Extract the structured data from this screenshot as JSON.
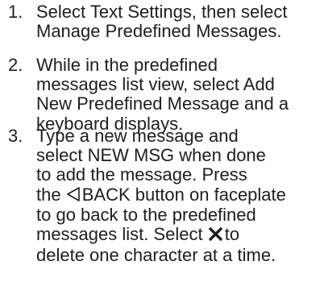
{
  "steps": [
    {
      "number": "1.",
      "lines": [
        "Select Text Settings, then select",
        "Manage Predefined Messages."
      ]
    },
    {
      "number": "2.",
      "lines": [
        "While in the predefined",
        "messages list view, select Add",
        "New Predefined Message and a",
        "keyboard displays."
      ]
    },
    {
      "number": "3.",
      "lines": [
        "Type a new message and",
        "select NEW MSG when done",
        "to add the message. Press",
        "the",
        "BACK button on faceplate",
        "to go back to the predefined",
        "messages list. Select",
        "to",
        "delete one character at a time."
      ],
      "icons": [
        "back-triangle-icon",
        "x-delete-icon"
      ]
    }
  ]
}
